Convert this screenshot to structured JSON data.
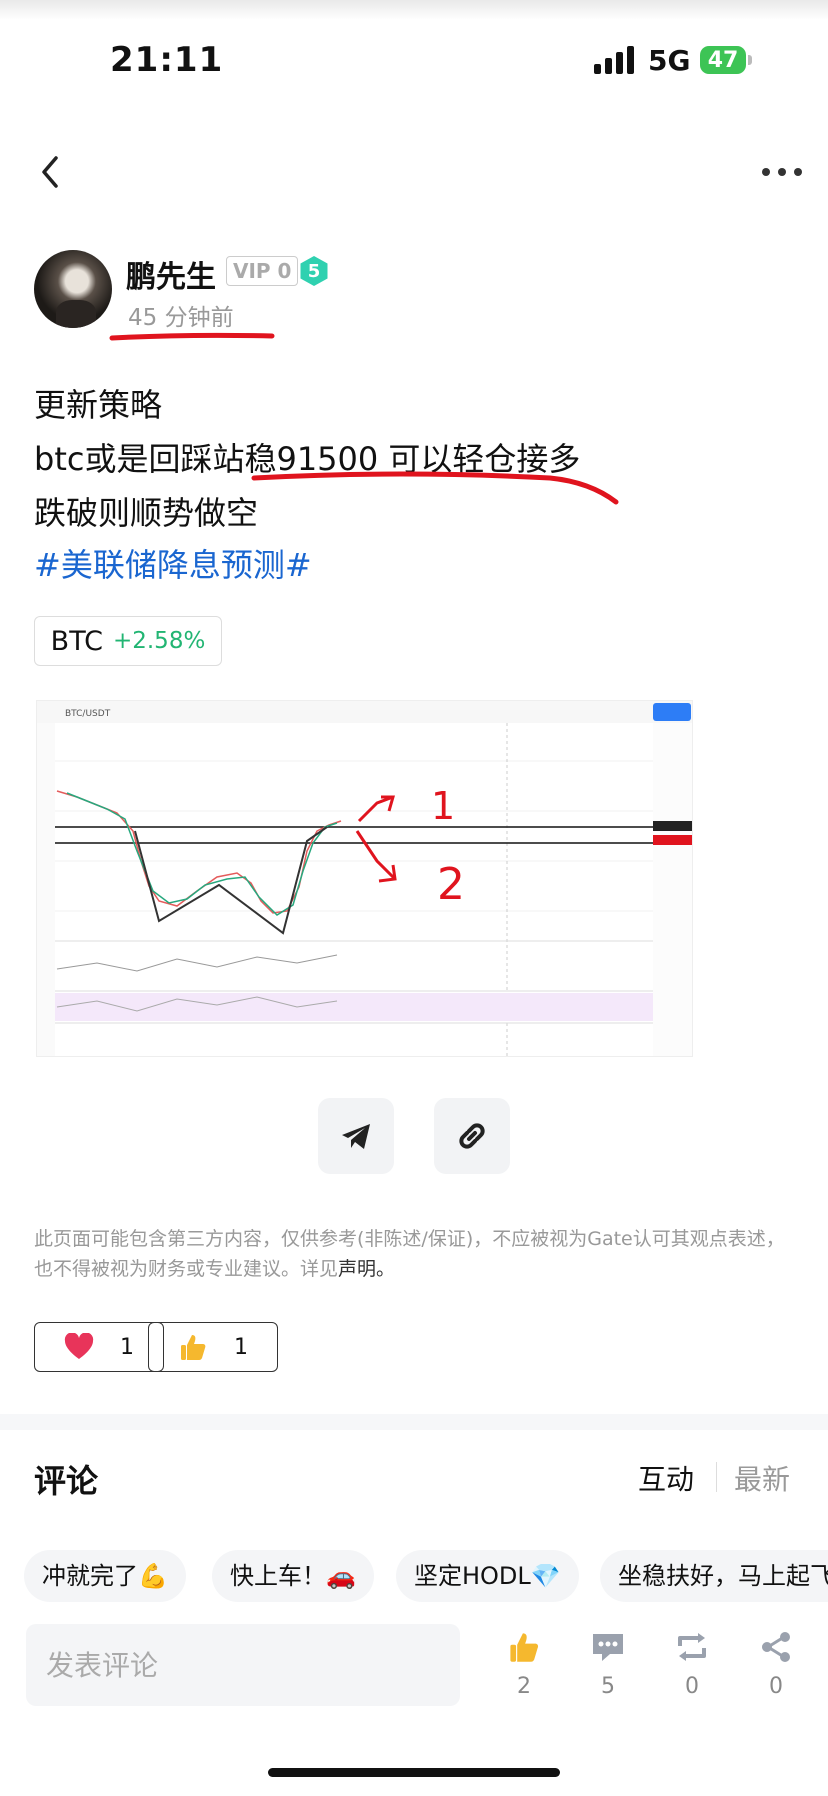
{
  "status_bar": {
    "time": "21:11",
    "network": "5G",
    "battery": "47"
  },
  "post": {
    "author": "鹏先生",
    "vip": "VIP 0",
    "level": "5",
    "time_ago": "45 分钟前",
    "lines": [
      "更新策略",
      "btc或是回踩站稳91500 可以轻仓接多",
      "跌破则顺势做空"
    ],
    "hashtag": "#美联储降息预测#",
    "ticker": {
      "symbol": "BTC",
      "change": "+2.58%"
    },
    "chart_image": {
      "title": "BTC/USDT",
      "annotations": [
        "1",
        "2"
      ]
    },
    "disclaimer": "此页面可能包含第三方内容，仅供参考(非陈述/保证)，不应被视为Gate认可其观点表述，也不得被视为财务或专业建议。详见",
    "disclaimer_link": "声明。",
    "reactions": [
      {
        "icon": "heart-icon",
        "count": "1"
      },
      {
        "icon": "thumbs-up-icon",
        "count": "1"
      }
    ]
  },
  "comments": {
    "title": "评论",
    "tab_interactive": "互动",
    "tab_latest": "最新",
    "quick_replies": [
      "冲就完了💪",
      "快上车！🚗",
      "坚定HODL💎",
      "坐稳扶好，马上起飞"
    ],
    "input_placeholder": "发表评论"
  },
  "bottom_stats": {
    "likes": "2",
    "comments": "5",
    "reposts": "0",
    "shares": "0"
  },
  "colors": {
    "accent_blue": "#1a66d0",
    "up_green": "#22b573",
    "level_badge": "#2fd1b0",
    "annotation_red": "#e0141e"
  }
}
